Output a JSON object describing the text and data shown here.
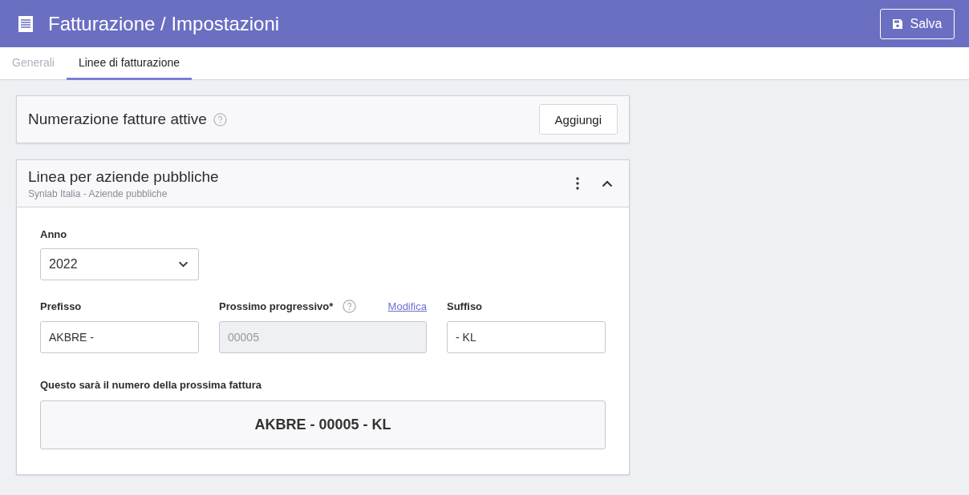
{
  "header": {
    "title": "Fatturazione / Impostazioni",
    "save_button": "Salva"
  },
  "tabs": [
    {
      "label": "Generali",
      "selected": false
    },
    {
      "label": "Linee di fatturazione",
      "selected": true
    }
  ],
  "numbering_card": {
    "title": "Numerazione fatture attive",
    "add_button": "Aggiungi"
  },
  "line_card": {
    "title": "Linea per aziende pubbliche",
    "subtitle": "Synlab Italia - Aziende pubbliche",
    "expanded": true,
    "year": {
      "label": "Anno",
      "value": "2022"
    },
    "fields": [
      {
        "label": "Prefisso",
        "value": "AKBRE -",
        "disabled": false
      },
      {
        "label": "Prossimo progressivo*",
        "value": "00005",
        "disabled": true,
        "help": true,
        "link": "Modifica"
      },
      {
        "label": "Suffiso",
        "value": "- KL",
        "disabled": false
      }
    ],
    "preview_label": "Questo sarà il numero della prossima fattura",
    "preview_value": "AKBRE - 00005 - KL"
  }
}
